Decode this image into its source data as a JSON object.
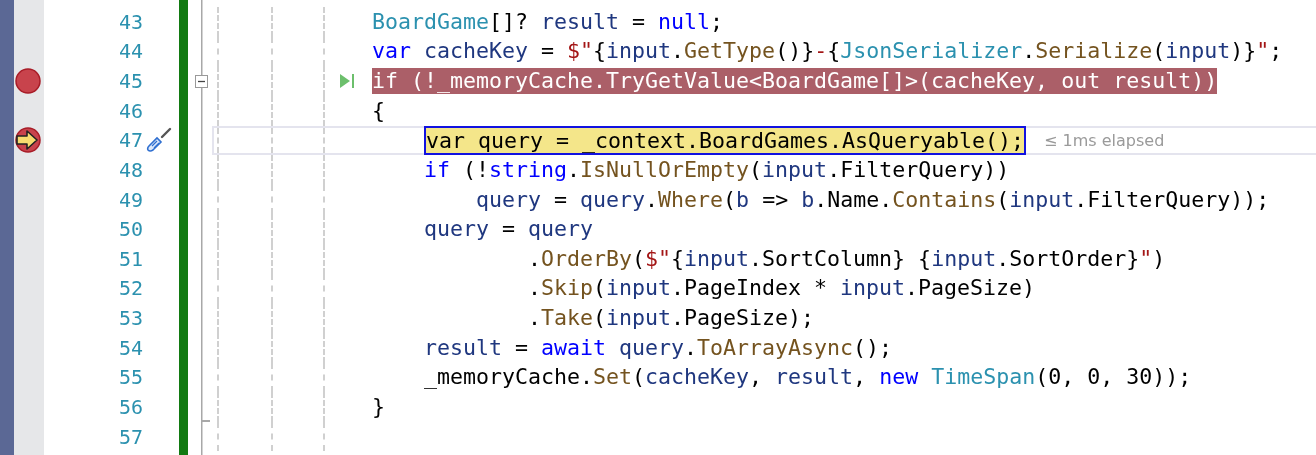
{
  "editor": {
    "lines": [
      {
        "number": "43",
        "breakpoint": false,
        "current": false,
        "run_to_cursor": false,
        "quick_action": false,
        "fold_start": false,
        "fold_end": false,
        "tokens": [
          {
            "text": "BoardGame",
            "kind": "type"
          },
          {
            "text": "[]? ",
            "kind": "punct"
          },
          {
            "text": "result",
            "kind": "var"
          },
          {
            "text": " = ",
            "kind": "punct"
          },
          {
            "text": "null",
            "kind": "keyword"
          },
          {
            "text": ";",
            "kind": "punct"
          }
        ]
      },
      {
        "number": "44",
        "breakpoint": false,
        "current": false,
        "run_to_cursor": false,
        "quick_action": false,
        "fold_start": false,
        "fold_end": false,
        "tokens": [
          {
            "text": "var",
            "kind": "keyword"
          },
          {
            "text": " cacheKey",
            "kind": "var"
          },
          {
            "text": " = ",
            "kind": "punct"
          },
          {
            "text": "$\"",
            "kind": "string"
          },
          {
            "text": "{",
            "kind": "punct"
          },
          {
            "text": "input",
            "kind": "var"
          },
          {
            "text": ".",
            "kind": "punct"
          },
          {
            "text": "GetType",
            "kind": "method"
          },
          {
            "text": "()}",
            "kind": "punct"
          },
          {
            "text": "-",
            "kind": "string"
          },
          {
            "text": "{",
            "kind": "punct"
          },
          {
            "text": "JsonSerializer",
            "kind": "type"
          },
          {
            "text": ".",
            "kind": "punct"
          },
          {
            "text": "Serialize",
            "kind": "method"
          },
          {
            "text": "(",
            "kind": "punct"
          },
          {
            "text": "input",
            "kind": "var"
          },
          {
            "text": ")}",
            "kind": "punct"
          },
          {
            "text": "\"",
            "kind": "string"
          },
          {
            "text": ";",
            "kind": "punct"
          }
        ]
      },
      {
        "number": "45",
        "breakpoint": true,
        "current": false,
        "run_to_cursor": true,
        "quick_action": false,
        "fold_start": true,
        "fold_end": false,
        "tokens": [
          {
            "text": "if",
            "kind": "keyword"
          },
          {
            "text": " (!_memoryCache.",
            "kind": "punct"
          },
          {
            "text": "TryGetValue",
            "kind": "method"
          },
          {
            "text": "<",
            "kind": "punct"
          },
          {
            "text": "BoardGame",
            "kind": "type"
          },
          {
            "text": "[]>(",
            "kind": "punct"
          },
          {
            "text": "cacheKey",
            "kind": "var"
          },
          {
            "text": ", ",
            "kind": "punct"
          },
          {
            "text": "out",
            "kind": "keyword"
          },
          {
            "text": " result",
            "kind": "var"
          },
          {
            "text": "))",
            "kind": "punct"
          }
        ]
      },
      {
        "number": "46",
        "breakpoint": false,
        "current": false,
        "run_to_cursor": false,
        "quick_action": false,
        "fold_start": false,
        "fold_end": false,
        "tokens": [
          {
            "text": "{",
            "kind": "punct"
          }
        ]
      },
      {
        "number": "47",
        "breakpoint": true,
        "current": true,
        "run_to_cursor": false,
        "quick_action": true,
        "fold_start": false,
        "fold_end": false,
        "hint": "≤ 1ms elapsed",
        "tokens": [
          {
            "text": "    var",
            "kind": "keyword"
          },
          {
            "text": " query",
            "kind": "var"
          },
          {
            "text": " = _context.BoardGames.",
            "kind": "punct"
          },
          {
            "text": "AsQueryable",
            "kind": "method"
          },
          {
            "text": "();",
            "kind": "punct"
          }
        ]
      },
      {
        "number": "48",
        "breakpoint": false,
        "current": false,
        "run_to_cursor": false,
        "quick_action": false,
        "fold_start": false,
        "fold_end": false,
        "tokens": [
          {
            "text": "    if",
            "kind": "keyword"
          },
          {
            "text": " (!",
            "kind": "punct"
          },
          {
            "text": "string",
            "kind": "keyword"
          },
          {
            "text": ".",
            "kind": "punct"
          },
          {
            "text": "IsNullOrEmpty",
            "kind": "method"
          },
          {
            "text": "(",
            "kind": "punct"
          },
          {
            "text": "input",
            "kind": "var"
          },
          {
            "text": ".FilterQuery))",
            "kind": "punct"
          }
        ]
      },
      {
        "number": "49",
        "breakpoint": false,
        "current": false,
        "run_to_cursor": false,
        "quick_action": false,
        "fold_start": false,
        "fold_end": false,
        "tokens": [
          {
            "text": "        query",
            "kind": "var"
          },
          {
            "text": " = ",
            "kind": "punct"
          },
          {
            "text": "query",
            "kind": "var"
          },
          {
            "text": ".",
            "kind": "punct"
          },
          {
            "text": "Where",
            "kind": "method"
          },
          {
            "text": "(",
            "kind": "punct"
          },
          {
            "text": "b",
            "kind": "var"
          },
          {
            "text": " => ",
            "kind": "punct"
          },
          {
            "text": "b",
            "kind": "var"
          },
          {
            "text": ".Name.",
            "kind": "punct"
          },
          {
            "text": "Contains",
            "kind": "method"
          },
          {
            "text": "(",
            "kind": "punct"
          },
          {
            "text": "input",
            "kind": "var"
          },
          {
            "text": ".FilterQuery));",
            "kind": "punct"
          }
        ]
      },
      {
        "number": "50",
        "breakpoint": false,
        "current": false,
        "run_to_cursor": false,
        "quick_action": false,
        "fold_start": false,
        "fold_end": false,
        "tokens": [
          {
            "text": "    query",
            "kind": "var"
          },
          {
            "text": " = ",
            "kind": "punct"
          },
          {
            "text": "query",
            "kind": "var"
          }
        ]
      },
      {
        "number": "51",
        "breakpoint": false,
        "current": false,
        "run_to_cursor": false,
        "quick_action": false,
        "fold_start": false,
        "fold_end": false,
        "tokens": [
          {
            "text": "            .",
            "kind": "punct"
          },
          {
            "text": "OrderBy",
            "kind": "method"
          },
          {
            "text": "(",
            "kind": "punct"
          },
          {
            "text": "$\"",
            "kind": "string"
          },
          {
            "text": "{",
            "kind": "punct"
          },
          {
            "text": "input",
            "kind": "var"
          },
          {
            "text": ".SortColumn} {",
            "kind": "punct"
          },
          {
            "text": "input",
            "kind": "var"
          },
          {
            "text": ".SortOrder}",
            "kind": "punct"
          },
          {
            "text": "\"",
            "kind": "string"
          },
          {
            "text": ")",
            "kind": "punct"
          }
        ]
      },
      {
        "number": "52",
        "breakpoint": false,
        "current": false,
        "run_to_cursor": false,
        "quick_action": false,
        "fold_start": false,
        "fold_end": false,
        "tokens": [
          {
            "text": "            .",
            "kind": "punct"
          },
          {
            "text": "Skip",
            "kind": "method"
          },
          {
            "text": "(",
            "kind": "punct"
          },
          {
            "text": "input",
            "kind": "var"
          },
          {
            "text": ".PageIndex * ",
            "kind": "punct"
          },
          {
            "text": "input",
            "kind": "var"
          },
          {
            "text": ".PageSize)",
            "kind": "punct"
          }
        ]
      },
      {
        "number": "53",
        "breakpoint": false,
        "current": false,
        "run_to_cursor": false,
        "quick_action": false,
        "fold_start": false,
        "fold_end": false,
        "tokens": [
          {
            "text": "            .",
            "kind": "punct"
          },
          {
            "text": "Take",
            "kind": "method"
          },
          {
            "text": "(",
            "kind": "punct"
          },
          {
            "text": "input",
            "kind": "var"
          },
          {
            "text": ".PageSize);",
            "kind": "punct"
          }
        ]
      },
      {
        "number": "54",
        "breakpoint": false,
        "current": false,
        "run_to_cursor": false,
        "quick_action": false,
        "fold_start": false,
        "fold_end": false,
        "tokens": [
          {
            "text": "    result",
            "kind": "var"
          },
          {
            "text": " = ",
            "kind": "punct"
          },
          {
            "text": "await",
            "kind": "keyword"
          },
          {
            "text": " query",
            "kind": "var"
          },
          {
            "text": ".",
            "kind": "punct"
          },
          {
            "text": "ToArrayAsync",
            "kind": "method"
          },
          {
            "text": "();",
            "kind": "punct"
          }
        ]
      },
      {
        "number": "55",
        "breakpoint": false,
        "current": false,
        "run_to_cursor": false,
        "quick_action": false,
        "fold_start": false,
        "fold_end": false,
        "tokens": [
          {
            "text": "    _memoryCache.",
            "kind": "punct"
          },
          {
            "text": "Set",
            "kind": "method"
          },
          {
            "text": "(",
            "kind": "punct"
          },
          {
            "text": "cacheKey",
            "kind": "var"
          },
          {
            "text": ", ",
            "kind": "punct"
          },
          {
            "text": "result",
            "kind": "var"
          },
          {
            "text": ", ",
            "kind": "punct"
          },
          {
            "text": "new",
            "kind": "keyword"
          },
          {
            "text": " TimeSpan",
            "kind": "type"
          },
          {
            "text": "(0, 0, 30));",
            "kind": "punct"
          }
        ]
      },
      {
        "number": "56",
        "breakpoint": false,
        "current": false,
        "run_to_cursor": false,
        "quick_action": false,
        "fold_start": false,
        "fold_end": true,
        "tokens": [
          {
            "text": "}",
            "kind": "punct"
          }
        ]
      },
      {
        "number": "57",
        "breakpoint": false,
        "current": false,
        "run_to_cursor": false,
        "quick_action": false,
        "fold_start": false,
        "fold_end": false
      }
    ]
  }
}
